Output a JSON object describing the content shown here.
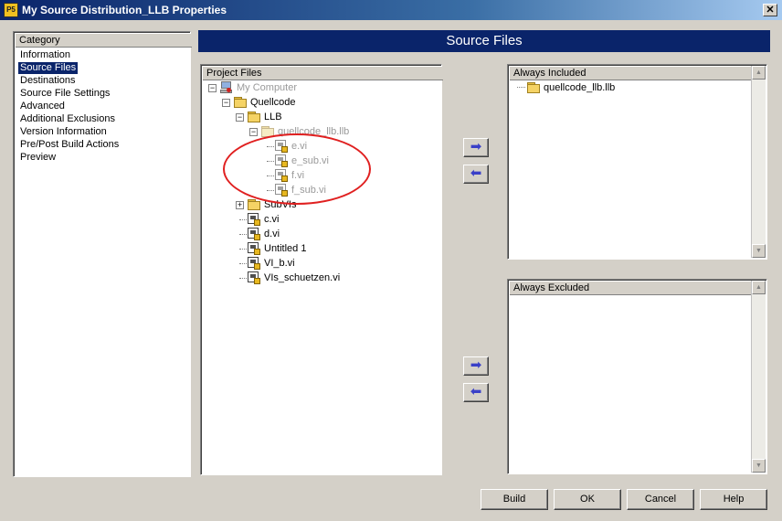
{
  "window": {
    "title": "My Source Distribution_LLB Properties",
    "app_icon_text": "P5",
    "close_glyph": "✕"
  },
  "category": {
    "header": "Category",
    "items": [
      {
        "label": "Information",
        "selected": false
      },
      {
        "label": "Source Files",
        "selected": true
      },
      {
        "label": "Destinations",
        "selected": false
      },
      {
        "label": "Source File Settings",
        "selected": false
      },
      {
        "label": "Advanced",
        "selected": false
      },
      {
        "label": "Additional Exclusions",
        "selected": false
      },
      {
        "label": "Version Information",
        "selected": false
      },
      {
        "label": "Pre/Post Build Actions",
        "selected": false
      },
      {
        "label": "Preview",
        "selected": false
      }
    ]
  },
  "section_title": "Source Files",
  "project_files": {
    "header": "Project Files",
    "tree": [
      {
        "label": "My Computer",
        "icon": "computer-icon",
        "depth": 0,
        "expander": "−",
        "dimmed": true
      },
      {
        "label": "Quellcode",
        "icon": "folder-icon",
        "depth": 1,
        "expander": "−",
        "dimmed": false
      },
      {
        "label": "LLB",
        "icon": "folder-icon",
        "depth": 2,
        "expander": "−",
        "dimmed": false
      },
      {
        "label": "quellcode_llb.llb",
        "icon": "folder-icon",
        "depth": 3,
        "expander": "−",
        "dimmed": true
      },
      {
        "label": "e.vi",
        "icon": "vi-icon",
        "depth": 4,
        "expander": "",
        "dimmed": true
      },
      {
        "label": "e_sub.vi",
        "icon": "vi-icon",
        "depth": 4,
        "expander": "",
        "dimmed": true
      },
      {
        "label": "f.vi",
        "icon": "vi-icon",
        "depth": 4,
        "expander": "",
        "dimmed": true
      },
      {
        "label": "f_sub.vi",
        "icon": "vi-icon",
        "depth": 4,
        "expander": "",
        "dimmed": true
      },
      {
        "label": "SubVIs",
        "icon": "folder-icon",
        "depth": 2,
        "expander": "+",
        "dimmed": false
      },
      {
        "label": "c.vi",
        "icon": "vi-icon",
        "depth": 2,
        "expander": "",
        "dimmed": false
      },
      {
        "label": "d.vi",
        "icon": "vi-icon",
        "depth": 2,
        "expander": "",
        "dimmed": false
      },
      {
        "label": "Untitled 1",
        "icon": "vi-icon",
        "depth": 2,
        "expander": "",
        "dimmed": false
      },
      {
        "label": "VI_b.vi",
        "icon": "vi-icon",
        "depth": 2,
        "expander": "",
        "dimmed": false
      },
      {
        "label": "VIs_schuetzen.vi",
        "icon": "vi-icon",
        "depth": 2,
        "expander": "",
        "dimmed": false
      }
    ]
  },
  "arrows": {
    "add_glyph": "➡",
    "remove_glyph": "⬅"
  },
  "always_included": {
    "header": "Always Included",
    "items": [
      {
        "label": "quellcode_llb.llb",
        "icon": "folder-icon"
      }
    ]
  },
  "always_excluded": {
    "header": "Always Excluded",
    "items": []
  },
  "scroll": {
    "up_glyph": "▲",
    "down_glyph": "▼"
  },
  "buttons": {
    "build": "Build",
    "ok": "OK",
    "cancel": "Cancel",
    "help": "Help"
  },
  "colors": {
    "banner": "#0a246a",
    "annotation_ellipse": "#e02020",
    "arrow": "#3a40c8"
  }
}
